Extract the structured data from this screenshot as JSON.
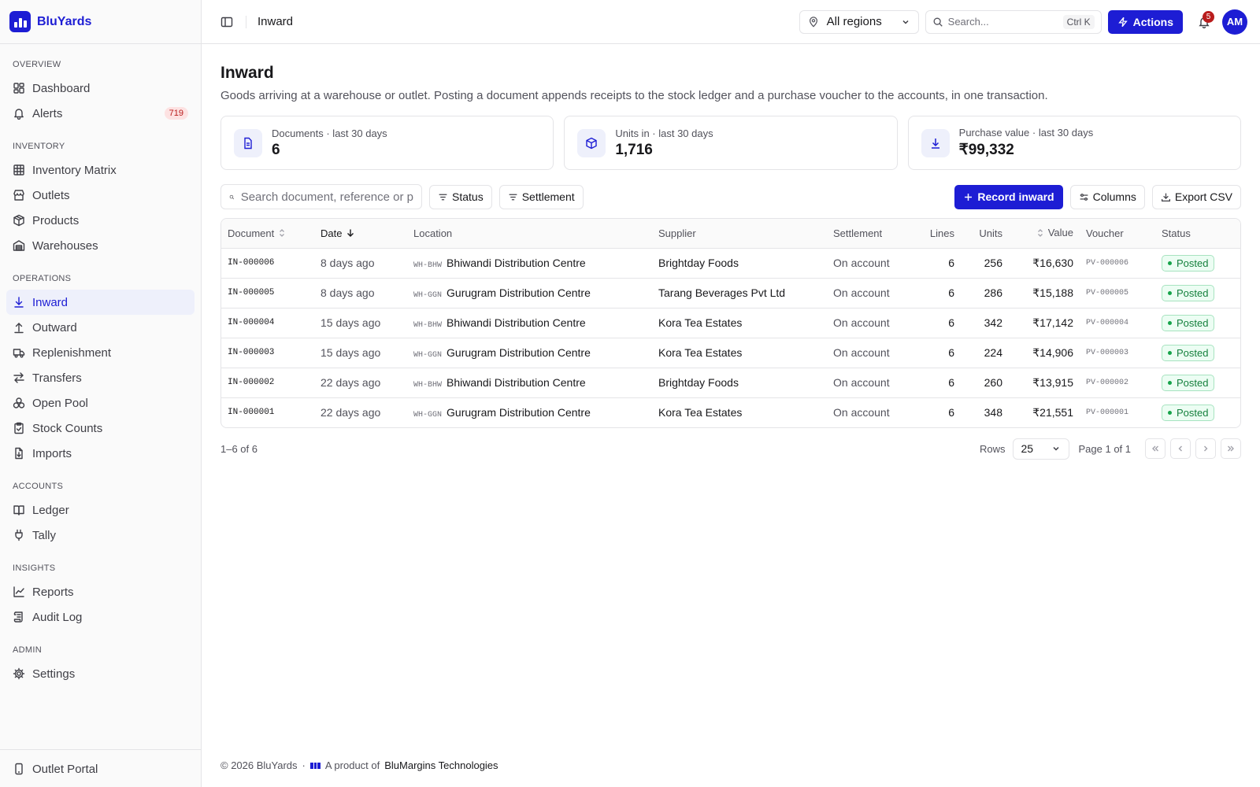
{
  "brand": {
    "name": "BluYards"
  },
  "sidebar": {
    "sections": [
      {
        "heading": "OVERVIEW",
        "items": [
          {
            "label": "Dashboard",
            "icon": "dashboard-icon"
          },
          {
            "label": "Alerts",
            "icon": "bell-icon",
            "badge": "719"
          }
        ]
      },
      {
        "heading": "INVENTORY",
        "items": [
          {
            "label": "Inventory Matrix",
            "icon": "grid-icon"
          },
          {
            "label": "Outlets",
            "icon": "store-icon"
          },
          {
            "label": "Products",
            "icon": "package-icon"
          },
          {
            "label": "Warehouses",
            "icon": "warehouse-icon"
          }
        ]
      },
      {
        "heading": "OPERATIONS",
        "items": [
          {
            "label": "Inward",
            "icon": "arrow-down-icon",
            "active": true
          },
          {
            "label": "Outward",
            "icon": "arrow-up-icon"
          },
          {
            "label": "Replenishment",
            "icon": "truck-icon"
          },
          {
            "label": "Transfers",
            "icon": "transfer-icon"
          },
          {
            "label": "Open Pool",
            "icon": "boxes-icon"
          },
          {
            "label": "Stock Counts",
            "icon": "clipboard-icon"
          },
          {
            "label": "Imports",
            "icon": "file-import-icon"
          }
        ]
      },
      {
        "heading": "ACCOUNTS",
        "items": [
          {
            "label": "Ledger",
            "icon": "book-icon"
          },
          {
            "label": "Tally",
            "icon": "plug-icon"
          }
        ]
      },
      {
        "heading": "INSIGHTS",
        "items": [
          {
            "label": "Reports",
            "icon": "chart-line-icon"
          },
          {
            "label": "Audit Log",
            "icon": "scroll-icon"
          }
        ]
      },
      {
        "heading": "ADMIN",
        "items": [
          {
            "label": "Settings",
            "icon": "gear-icon"
          }
        ]
      }
    ],
    "footer_item": {
      "label": "Outlet Portal",
      "icon": "phone-icon"
    }
  },
  "topbar": {
    "breadcrumb": "Inward",
    "region": "All regions",
    "search_placeholder": "Search...",
    "search_shortcut": "Ctrl K",
    "actions_label": "Actions",
    "notifications_count": "5",
    "avatar_initials": "AM"
  },
  "page": {
    "title": "Inward",
    "description": "Goods arriving at a warehouse or outlet. Posting a document appends receipts to the stock ledger and a purchase voucher to the accounts, in one transaction."
  },
  "stats": [
    {
      "label": "Documents · last 30 days",
      "value": "6",
      "icon": "document-icon"
    },
    {
      "label": "Units in · last 30 days",
      "value": "1,716",
      "icon": "box-icon"
    },
    {
      "label": "Purchase value · last 30 days",
      "value": "₹99,332",
      "icon": "download-icon"
    }
  ],
  "toolbar": {
    "search_placeholder": "Search document, reference or p",
    "filter_status": "Status",
    "filter_settlement": "Settlement",
    "record_inward": "Record inward",
    "columns": "Columns",
    "export_csv": "Export CSV"
  },
  "table": {
    "columns": [
      "Document",
      "Date",
      "Location",
      "Supplier",
      "Settlement",
      "Lines",
      "Units",
      "Value",
      "Voucher",
      "Status"
    ],
    "rows": [
      {
        "document": "IN-000006",
        "date": "8 days ago",
        "loc_code": "WH-BHW",
        "location": "Bhiwandi Distribution Centre",
        "supplier": "Brightday Foods",
        "settlement": "On account",
        "lines": "6",
        "units": "256",
        "value": "₹16,630",
        "voucher": "PV-000006",
        "status": "Posted"
      },
      {
        "document": "IN-000005",
        "date": "8 days ago",
        "loc_code": "WH-GGN",
        "location": "Gurugram Distribution Centre",
        "supplier": "Tarang Beverages Pvt Ltd",
        "settlement": "On account",
        "lines": "6",
        "units": "286",
        "value": "₹15,188",
        "voucher": "PV-000005",
        "status": "Posted"
      },
      {
        "document": "IN-000004",
        "date": "15 days ago",
        "loc_code": "WH-BHW",
        "location": "Bhiwandi Distribution Centre",
        "supplier": "Kora Tea Estates",
        "settlement": "On account",
        "lines": "6",
        "units": "342",
        "value": "₹17,142",
        "voucher": "PV-000004",
        "status": "Posted"
      },
      {
        "document": "IN-000003",
        "date": "15 days ago",
        "loc_code": "WH-GGN",
        "location": "Gurugram Distribution Centre",
        "supplier": "Kora Tea Estates",
        "settlement": "On account",
        "lines": "6",
        "units": "224",
        "value": "₹14,906",
        "voucher": "PV-000003",
        "status": "Posted"
      },
      {
        "document": "IN-000002",
        "date": "22 days ago",
        "loc_code": "WH-BHW",
        "location": "Bhiwandi Distribution Centre",
        "supplier": "Brightday Foods",
        "settlement": "On account",
        "lines": "6",
        "units": "260",
        "value": "₹13,915",
        "voucher": "PV-000002",
        "status": "Posted"
      },
      {
        "document": "IN-000001",
        "date": "22 days ago",
        "loc_code": "WH-GGN",
        "location": "Gurugram Distribution Centre",
        "supplier": "Kora Tea Estates",
        "settlement": "On account",
        "lines": "6",
        "units": "348",
        "value": "₹21,551",
        "voucher": "PV-000001",
        "status": "Posted"
      }
    ]
  },
  "pagination": {
    "range": "1–6 of 6",
    "rows_label": "Rows",
    "rows_value": "25",
    "page_label": "Page 1 of 1"
  },
  "footer": {
    "copyright": "© 2026 BluYards",
    "separator": "·",
    "product_of": "A product of",
    "company": "BluMargins Technologies"
  },
  "colors": {
    "accent": "#1d1dd4",
    "success": "#15803d",
    "danger": "#b91c1c"
  }
}
